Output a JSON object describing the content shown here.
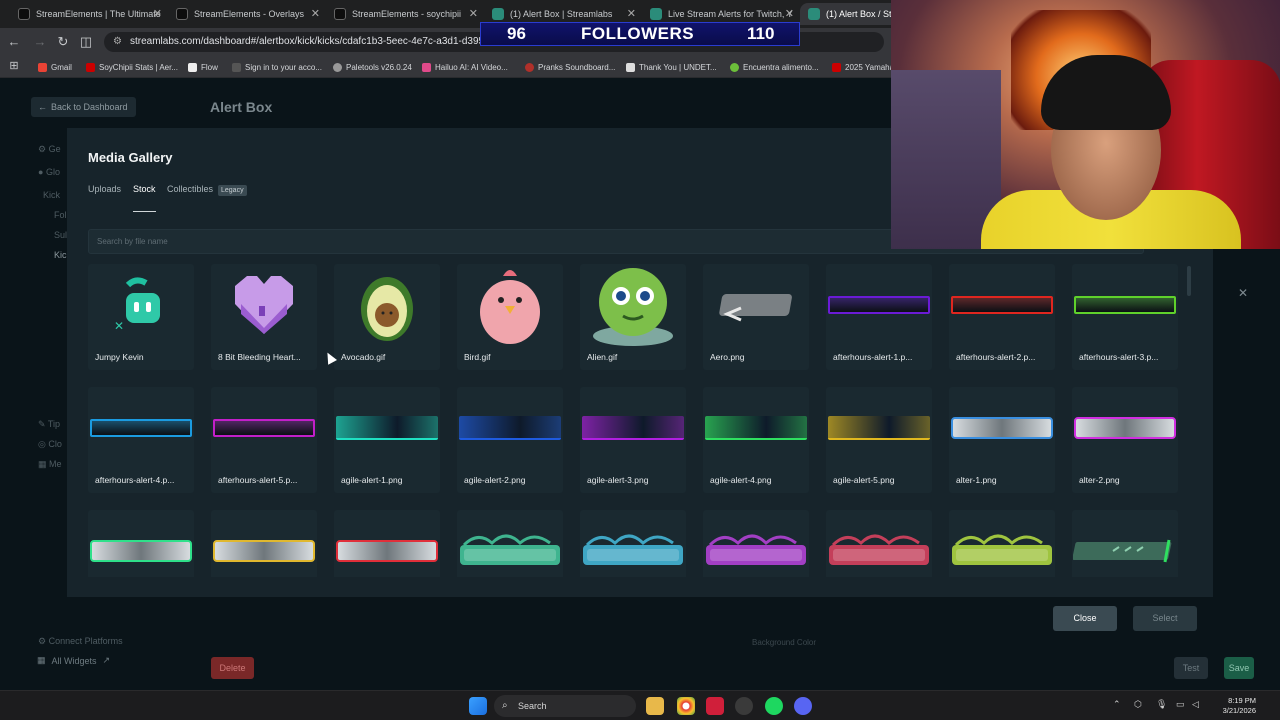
{
  "browser": {
    "tabs": [
      {
        "label": "StreamElements | The Ultimate",
        "active": false
      },
      {
        "label": "StreamElements - Overlays",
        "active": false
      },
      {
        "label": "StreamElements - soychipii",
        "active": false
      },
      {
        "label": "(1) Alert Box | Streamlabs",
        "active": false
      },
      {
        "label": "Live Stream Alerts for Twitch, Y",
        "active": false
      },
      {
        "label": "(1) Alert Box / Strea",
        "active": true
      }
    ],
    "url": "streamlabs.com/dashboard#/alertbox/kick/kicks/cdafc1b3-5eec-4e7c-a3d1-d3956d0",
    "bookmarks": [
      "Gmail",
      "SoyChipii Stats | Aer...",
      "Flow",
      "Sign in to your acco...",
      "Paletools v26.0.24",
      "Hailuo AI: AI Video...",
      "Pranks Soundboard...",
      "Thank You | UNDET...",
      "Encuentra alimento...",
      "2025 Yamaha"
    ]
  },
  "overlay": {
    "followers_current": "96",
    "followers_label": "FOLLOWERS",
    "followers_goal": "110"
  },
  "background_page": {
    "back_label": "Back to Dashboard",
    "title": "Alert Box",
    "sidebar": [
      "Ge",
      "Glo",
      "Kick",
      "Fol",
      "Sul",
      "Kic",
      "Tip",
      "Clo",
      "Me"
    ],
    "connect_label": "Connect Platforms",
    "all_widgets": "All Widgets",
    "delete_label": "Delete",
    "test_label": "Test",
    "save_label": "Save",
    "bg_color_label": "Background Color"
  },
  "modal": {
    "title": "Media Gallery",
    "tabs": [
      "Uploads",
      "Stock",
      "Collectibles"
    ],
    "active_tab": "Stock",
    "legacy_badge": "Legacy",
    "search_placeholder": "Search by file name",
    "close_label": "Close",
    "select_label": "Select",
    "items_row1": [
      {
        "name": "Jumpy Kevin",
        "kind": "kevin"
      },
      {
        "name": "8 Bit Bleeding Heart...",
        "kind": "heart"
      },
      {
        "name": "Avocado.gif",
        "kind": "avocado"
      },
      {
        "name": "Bird.gif",
        "kind": "bird"
      },
      {
        "name": "Alien.gif",
        "kind": "alien"
      },
      {
        "name": "Aero.png",
        "kind": "aero"
      },
      {
        "name": "afterhours-alert-1.p...",
        "kind": "bar",
        "color": "#6b1bd6"
      },
      {
        "name": "afterhours-alert-2.p...",
        "kind": "bar",
        "color": "#e0261f"
      },
      {
        "name": "afterhours-alert-3.p...",
        "kind": "bar",
        "color": "#5fd12b"
      }
    ],
    "items_row2": [
      {
        "name": "afterhours-alert-4.p...",
        "kind": "bar",
        "color": "#1b9be0"
      },
      {
        "name": "afterhours-alert-5.p...",
        "kind": "bar",
        "color": "#c21fc9"
      },
      {
        "name": "agile-alert-1.png",
        "kind": "agile",
        "color": "#1fe0c2"
      },
      {
        "name": "agile-alert-2.png",
        "kind": "agile",
        "color": "#1f5be0"
      },
      {
        "name": "agile-alert-3.png",
        "kind": "agile",
        "color": "#b01fe0"
      },
      {
        "name": "agile-alert-4.png",
        "kind": "agile",
        "color": "#2fe060"
      },
      {
        "name": "agile-alert-5.png",
        "kind": "agile",
        "color": "#e0b81f"
      },
      {
        "name": "alter-1.png",
        "kind": "alter",
        "color": "#3a8fe0"
      },
      {
        "name": "alter-2.png",
        "kind": "alter",
        "color": "#d02fe0"
      }
    ],
    "items_row3": [
      {
        "name": "",
        "kind": "alter",
        "color": "#2fe08a"
      },
      {
        "name": "",
        "kind": "alter",
        "color": "#e0b82f"
      },
      {
        "name": "",
        "kind": "alter",
        "color": "#e02f3a"
      },
      {
        "name": "",
        "kind": "vine",
        "color": "#3fb48f"
      },
      {
        "name": "",
        "kind": "vine",
        "color": "#3fa6c4"
      },
      {
        "name": "",
        "kind": "vine",
        "color": "#a23fc4"
      },
      {
        "name": "",
        "kind": "vine",
        "color": "#c43f5a"
      },
      {
        "name": "",
        "kind": "vine",
        "color": "#9fc43f"
      },
      {
        "name": "",
        "kind": "arrowbar",
        "color": "#2fe060"
      }
    ]
  },
  "taskbar": {
    "search_label": "Search",
    "time": "8:19 PM",
    "date": "3/21/2026"
  }
}
